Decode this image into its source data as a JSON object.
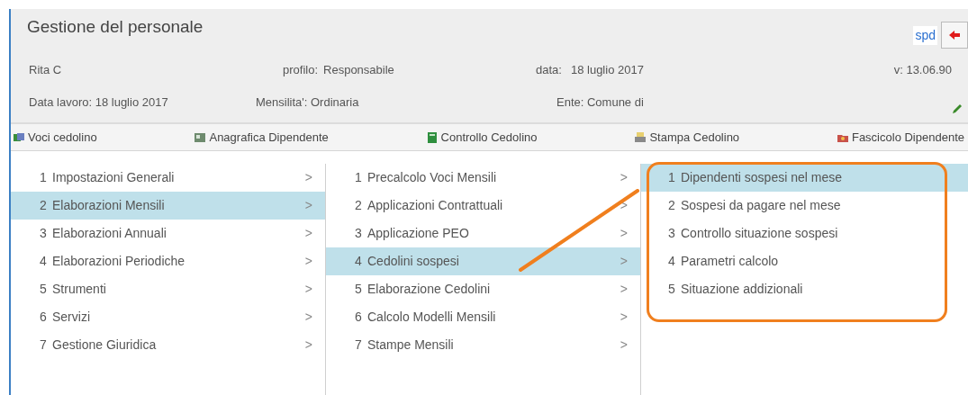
{
  "window": {
    "title": "Gestione del personale",
    "brand": "spd"
  },
  "info": {
    "user": "Rita C",
    "profile_label": "profilo:",
    "profile": "Responsabile",
    "date_label": "data:",
    "date": "18 luglio 2017",
    "version": "v: 13.06.90",
    "work_date": "Data lavoro: 18 luglio 2017",
    "month": "Mensilita': Ordinaria",
    "entity": "Ente: Comune di"
  },
  "toolbar": [
    {
      "label": "Voci cedolino",
      "kind": "tags"
    },
    {
      "label": "Anagrafica Dipendente",
      "kind": "card"
    },
    {
      "label": "Controllo Cedolino",
      "kind": "book"
    },
    {
      "label": "Stampa Cedolino",
      "kind": "printer"
    },
    {
      "label": "Fascicolo Dipendente",
      "kind": "folder"
    }
  ],
  "menus": [
    {
      "items": [
        {
          "number": "1",
          "label": "Impostazioni Generali",
          "arrow": ">",
          "selected": false
        },
        {
          "number": "2",
          "label": "Elaborazioni Mensili",
          "arrow": ">",
          "selected": true
        },
        {
          "number": "3",
          "label": "Elaborazioni Annuali",
          "arrow": ">",
          "selected": false
        },
        {
          "number": "4",
          "label": "Elaborazioni Periodiche",
          "arrow": ">",
          "selected": false
        },
        {
          "number": "5",
          "label": "Strumenti",
          "arrow": ">",
          "selected": false
        },
        {
          "number": "6",
          "label": "Servizi",
          "arrow": ">",
          "selected": false
        },
        {
          "number": "7",
          "label": "Gestione Giuridica",
          "arrow": ">",
          "selected": false
        }
      ]
    },
    {
      "items": [
        {
          "number": "1",
          "label": "Precalcolo Voci Mensili",
          "arrow": ">",
          "selected": false
        },
        {
          "number": "2",
          "label": "Applicazioni Contrattuali",
          "arrow": ">",
          "selected": false
        },
        {
          "number": "3",
          "label": "Applicazione PEO",
          "arrow": ">",
          "selected": false
        },
        {
          "number": "4",
          "label": "Cedolini sospesi",
          "arrow": ">",
          "selected": true
        },
        {
          "number": "5",
          "label": "Elaborazione Cedolini",
          "arrow": ">",
          "selected": false
        },
        {
          "number": "6",
          "label": "Calcolo Modelli Mensili",
          "arrow": ">",
          "selected": false
        },
        {
          "number": "7",
          "label": "Stampe Mensili",
          "arrow": ">",
          "selected": false
        }
      ]
    },
    {
      "items": [
        {
          "number": "1",
          "label": "Dipendenti sospesi nel mese",
          "selected": true
        },
        {
          "number": "2",
          "label": "Sospesi da pagare nel mese",
          "selected": false
        },
        {
          "number": "3",
          "label": "Controllo situazione sospesi",
          "selected": false
        },
        {
          "number": "4",
          "label": "Parametri calcolo",
          "selected": false
        },
        {
          "number": "5",
          "label": "Situazione addizionali",
          "selected": false
        }
      ]
    }
  ]
}
